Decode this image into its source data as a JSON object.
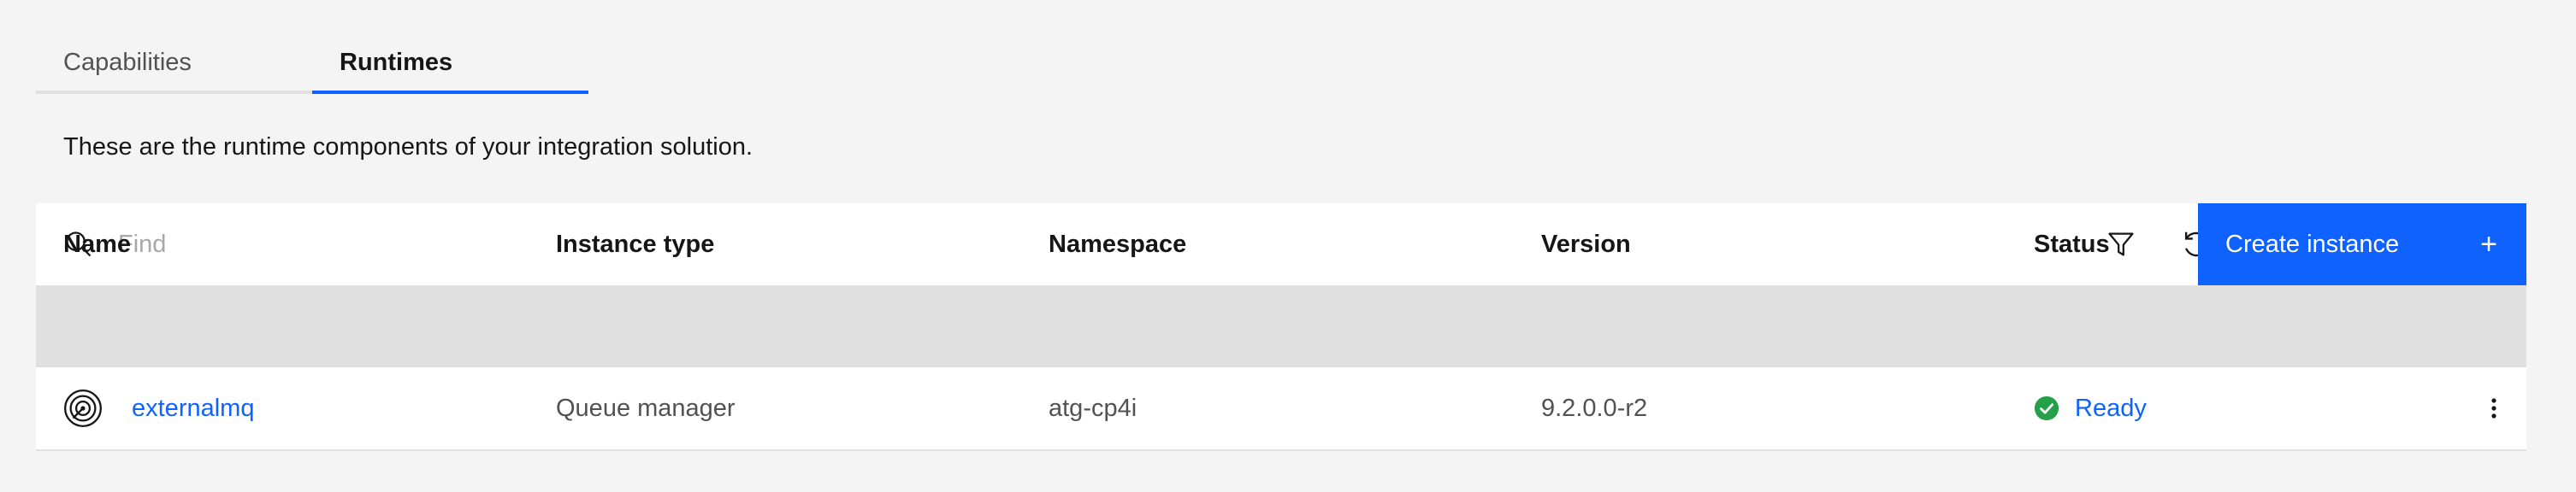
{
  "tabs": [
    {
      "label": "Capabilities",
      "active": false
    },
    {
      "label": "Runtimes",
      "active": true
    }
  ],
  "description": "These are the runtime components of your integration solution.",
  "toolbar": {
    "search_placeholder": "Find",
    "search_value": "",
    "filter_icon": "filter-icon",
    "refresh_icon": "refresh-icon",
    "create_label": "Create instance",
    "create_icon": "+"
  },
  "table": {
    "columns": [
      "Name",
      "Instance type",
      "Namespace",
      "Version",
      "Status"
    ],
    "rows": [
      {
        "icon": "queue-manager-icon",
        "name": "externalmq",
        "instance_type": "Queue manager",
        "namespace": "atg-cp4i",
        "version": "9.2.0.0-r2",
        "status": "Ready",
        "status_icon": "checkmark-filled-icon",
        "status_color": "#24a148"
      }
    ]
  },
  "colors": {
    "accent": "#0f62fe",
    "background": "#f4f4f4",
    "header_bg": "#e0e0e0",
    "success": "#24a148"
  }
}
